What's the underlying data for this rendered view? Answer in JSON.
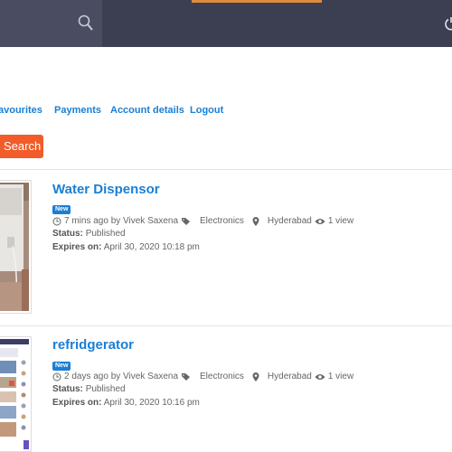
{
  "nav": {
    "favourites": "avourites",
    "payments": "Payments",
    "account_details": "Account details",
    "logout": "Logout"
  },
  "search_button": "Search",
  "listings": [
    {
      "title": "Water Dispensor",
      "badge": "New",
      "time": "7 mins ago by Vivek Saxena",
      "category": "Electronics",
      "location": "Hyderabad",
      "views": "1 view",
      "status_label": "Status:",
      "status_value": "Published",
      "expires_label": "Expires on:",
      "expires_value": "April 30, 2020 10:18 pm"
    },
    {
      "title": "refridgerator",
      "badge": "New",
      "time": "2 days ago by Vivek Saxena",
      "category": "Electronics",
      "location": "Hyderabad",
      "views": "1 view",
      "status_label": "Status:",
      "status_value": "Published",
      "expires_label": "Expires on:",
      "expires_value": "April 30, 2020 10:16 pm"
    }
  ],
  "colors": {
    "topbar": "#3c3f52",
    "link": "#1a7fd4",
    "button": "#f25c2a"
  }
}
